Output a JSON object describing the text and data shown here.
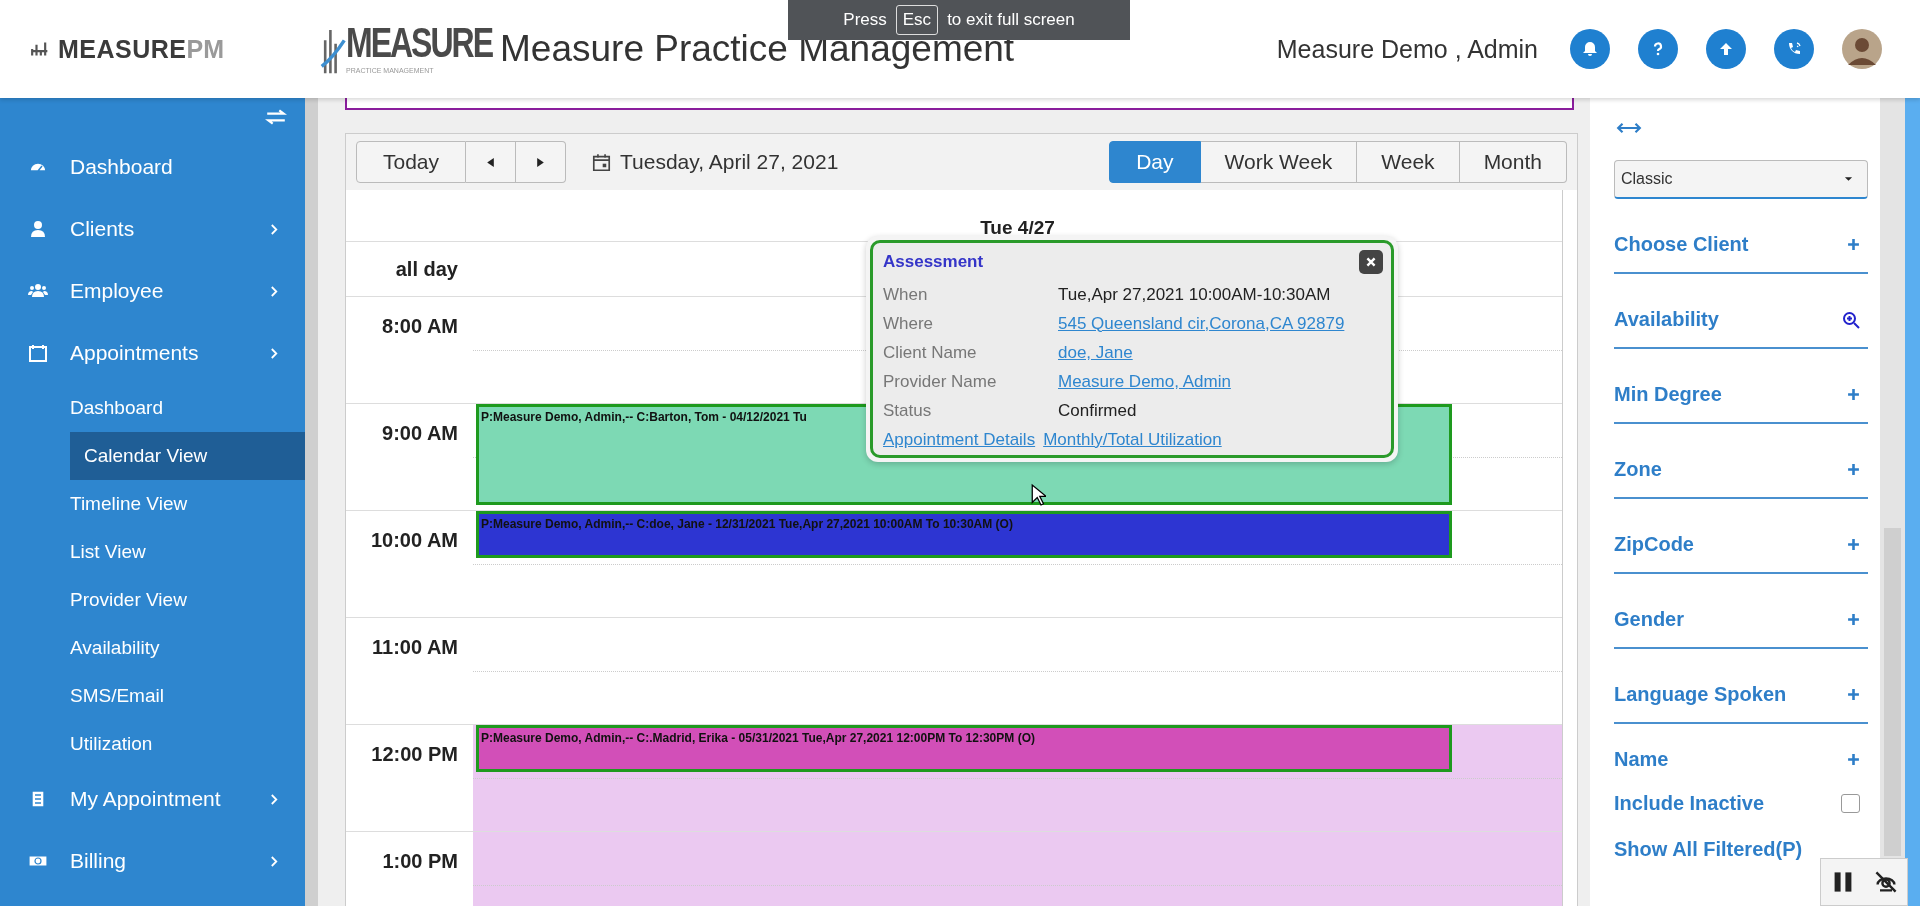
{
  "fullscreen_notice": {
    "before": "Press",
    "key": "Esc",
    "after": "to exit full screen"
  },
  "header": {
    "logo": {
      "main": "MEASURE",
      "suffix": "PM"
    },
    "brand": {
      "name": "MEASURE",
      "tagline": "PRACTICE MANAGEMENT"
    },
    "title": "Measure Practice Management",
    "user": "Measure Demo , Admin"
  },
  "sidebar": {
    "items": [
      {
        "label": "Dashboard",
        "expandable": false,
        "selected": false
      },
      {
        "label": "Clients",
        "expandable": true,
        "selected": false
      },
      {
        "label": "Employee",
        "expandable": true,
        "selected": false
      },
      {
        "label": "Appointments",
        "expandable": true,
        "selected": false,
        "children": [
          {
            "label": "Dashboard",
            "selected": false
          },
          {
            "label": "Calendar View",
            "selected": true
          },
          {
            "label": "Timeline View",
            "selected": false
          },
          {
            "label": "List View",
            "selected": false
          },
          {
            "label": "Provider View",
            "selected": false
          },
          {
            "label": "Availability",
            "selected": false
          },
          {
            "label": "SMS/Email",
            "selected": false
          },
          {
            "label": "Utilization",
            "selected": false
          }
        ]
      },
      {
        "label": "My Appointment",
        "expandable": true,
        "selected": false
      },
      {
        "label": "Billing",
        "expandable": true,
        "selected": false
      }
    ]
  },
  "calendar": {
    "today": "Today",
    "date": "Tuesday, April 27, 2021",
    "views": [
      {
        "label": "Day",
        "selected": true
      },
      {
        "label": "Work Week",
        "selected": false
      },
      {
        "label": "Week",
        "selected": false
      },
      {
        "label": "Month",
        "selected": false
      }
    ],
    "day_header": "Tue 4/27",
    "all_day": "all day",
    "hours": [
      {
        "label": "8:00 AM",
        "shaded": false
      },
      {
        "label": "9:00 AM",
        "shaded": false,
        "events": [
          {
            "text": "P:Measure Demo, Admin,-- C:Barton, Tom - 04/12/2021 Tu",
            "color": "#7dd9b4",
            "kind": "hour"
          }
        ]
      },
      {
        "label": "10:00 AM",
        "shaded": false,
        "events": [
          {
            "text": "P:Measure Demo, Admin,-- C:doe, Jane - 12/31/2021 Tue,Apr 27,2021 10:00AM To 10:30AM (O)",
            "color": "#2d35d2",
            "kind": "half-hour"
          }
        ]
      },
      {
        "label": "11:00 AM",
        "shaded": false
      },
      {
        "label": "12:00 PM",
        "shaded": true,
        "events": [
          {
            "text": "P:Measure Demo, Admin,-- C:.Madrid, Erika - 05/31/2021 Tue,Apr 27,2021 12:00PM To 12:30PM (O)",
            "color": "#d24fb8",
            "kind": "half-hour"
          }
        ]
      },
      {
        "label": "1:00 PM",
        "shaded": true
      }
    ]
  },
  "popup": {
    "title": "Assessment",
    "rows": [
      {
        "label": "When",
        "value": "Tue,Apr 27,2021 10:00AM-10:30AM",
        "link": false
      },
      {
        "label": "Where",
        "value": "545 Queensland cir,Corona,CA 92879",
        "link": true
      },
      {
        "label": "Client Name",
        "value": "doe, Jane",
        "link": true
      },
      {
        "label": "Provider Name",
        "value": "Measure Demo, Admin",
        "link": true
      },
      {
        "label": "Status",
        "value": "Confirmed",
        "link": false
      }
    ],
    "links": [
      "Appointment Details",
      "Monthly/Total Utilization"
    ]
  },
  "filters": {
    "layout": "Classic",
    "items": [
      {
        "label": "Choose Client",
        "kind": "add"
      },
      {
        "label": "Availability",
        "kind": "search"
      },
      {
        "label": "Min Degree",
        "kind": "add"
      },
      {
        "label": "Zone",
        "kind": "add"
      },
      {
        "label": "ZipCode",
        "kind": "add"
      },
      {
        "label": "Gender",
        "kind": "add"
      },
      {
        "label": "Language Spoken",
        "kind": "add"
      },
      {
        "label": "Name",
        "kind": "plain-add"
      }
    ],
    "include_inactive": {
      "label": "Include Inactive",
      "checked": false
    },
    "show_all": "Show All Filtered(P)"
  }
}
